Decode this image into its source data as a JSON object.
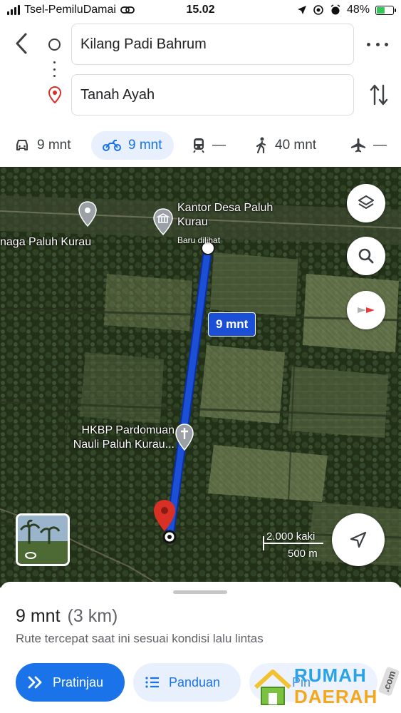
{
  "status_bar": {
    "carrier": "Tsel-PemiluDamai",
    "time": "15.02",
    "battery": "48%",
    "battery_level": 0.48
  },
  "directions": {
    "from": "Kilang Padi Bahrum",
    "to": "Tanah Ayah"
  },
  "modes": [
    {
      "name": "car",
      "label": "9 mnt",
      "icon": "car-icon",
      "active": false
    },
    {
      "name": "motorcycle",
      "label": "9 mnt",
      "icon": "motorcycle-icon",
      "active": true
    },
    {
      "name": "transit",
      "label": "—",
      "icon": "train-icon",
      "active": false
    },
    {
      "name": "walk",
      "label": "40 mnt",
      "icon": "walk-icon",
      "active": false
    },
    {
      "name": "flight",
      "label": "—",
      "icon": "plane-icon",
      "active": false
    }
  ],
  "map": {
    "places": {
      "village_office": "Kantor Desa Paluh Kurau",
      "village_office_sub": "Baru dilihat",
      "left_place": "naga Paluh Kurau",
      "church": "HKBP Pardomuan Nauli Paluh Kurau..."
    },
    "route_label": "9 mnt",
    "scale_imperial": "2.000 kaki",
    "scale_metric": "500 m",
    "route_color": "#1a4fd6"
  },
  "sheet": {
    "duration": "9 mnt",
    "distance": "(3 km)",
    "description": "Rute tercepat saat ini sesuai kondisi lalu lintas",
    "preview_label": "Pratinjau",
    "guide_label": "Panduan",
    "third_label": "Pin"
  },
  "watermark": {
    "line1": "RUMAH",
    "line2": "DAERAH",
    "suffix": ".com"
  }
}
